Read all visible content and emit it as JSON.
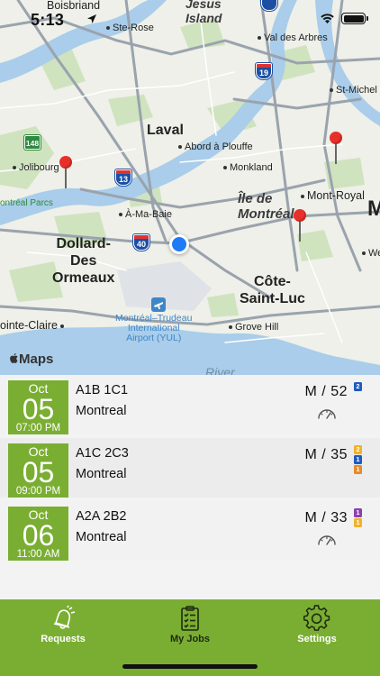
{
  "status_bar": {
    "time": "5:13"
  },
  "map": {
    "attribution": "Maps",
    "labels": {
      "boisbriand": "Boisbriand",
      "ste_rose": "Ste-Rose",
      "jesus_island_1": "Jesus",
      "jesus_island_2": "Island",
      "val_des_arbres": "Val des Arbres",
      "st_michel": "St-Michel",
      "laval": "Laval",
      "abord_a_plouffe": "Abord à Plouffe",
      "monkland": "Monkland",
      "jolibourg": "Jolibourg",
      "montreal_parcs": "ontréal Parcs",
      "a_ma_baie": "À-Ma-Baie",
      "ile_de_1": "Île de",
      "ile_de_2": "Montréal",
      "mont_royal": "Mont-Royal",
      "dollard_1": "Dollard-",
      "dollard_2": "Des",
      "dollard_3": "Ormeaux",
      "cote_1": "Côte-",
      "cote_2": "Saint-Luc",
      "pointe_claire": "ointe-Claire",
      "airport_1": "Montréal–Trudeau",
      "airport_2": "International",
      "airport_3": "Airport (YUL)",
      "grove_hill": "Grove Hill",
      "we": "We",
      "river": "River",
      "m_edge": "M"
    },
    "shields": {
      "hwy_19": "19",
      "hwy_13": "13",
      "hwy_40": "40",
      "hwy_148": "148",
      "hwy_top": ""
    }
  },
  "jobs": [
    {
      "month": "Oct",
      "day": "05",
      "time": "07:00 PM",
      "code": "A1B 1C1",
      "city": "Montreal",
      "size": "M / 52",
      "badges": [
        {
          "label": "2",
          "color": "#1f5bbf"
        }
      ],
      "show_gauge": true
    },
    {
      "month": "Oct",
      "day": "05",
      "time": "09:00 PM",
      "code": "A1C 2C3",
      "city": "Montreal",
      "size": "M / 35",
      "badges": [
        {
          "label": "2",
          "color": "#f0b22a"
        },
        {
          "label": "1",
          "color": "#1f5bbf"
        },
        {
          "label": "1",
          "color": "#e8892a"
        }
      ],
      "show_gauge": false
    },
    {
      "month": "Oct",
      "day": "06",
      "time": "11:00 AM",
      "code": "A2A 2B2",
      "city": "Montreal",
      "size": "M / 33",
      "badges": [
        {
          "label": "1",
          "color": "#8b3fb3"
        },
        {
          "label": "1",
          "color": "#f0b22a"
        }
      ],
      "show_gauge": true
    }
  ],
  "tabs": {
    "requests": "Requests",
    "my_jobs": "My Jobs",
    "settings": "Settings",
    "active": "my_jobs"
  },
  "colors": {
    "accent_green": "#7aae32",
    "pin_red": "#e8302a",
    "user_blue": "#1f7af5"
  }
}
